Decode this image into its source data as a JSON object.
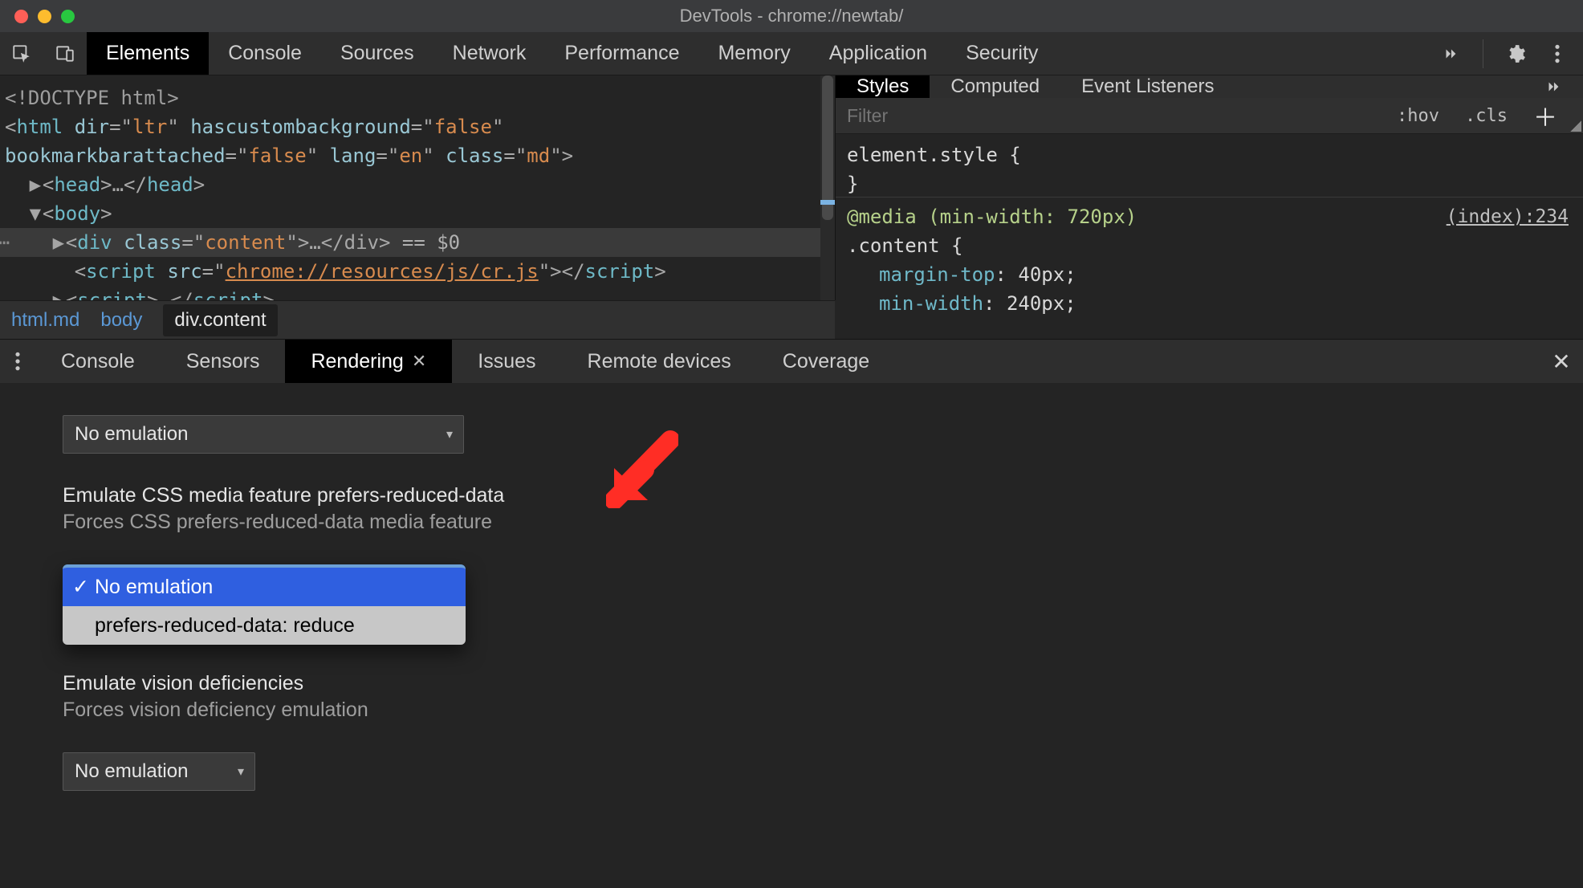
{
  "window": {
    "title": "DevTools - chrome://newtab/"
  },
  "toolbar": {
    "tabs": [
      "Elements",
      "Console",
      "Sources",
      "Network",
      "Performance",
      "Memory",
      "Application",
      "Security"
    ],
    "active": "Elements"
  },
  "dom": {
    "doctype": "<!DOCTYPE html>",
    "html_open_a": "<html ",
    "html_attr_dir_n": "dir",
    "html_attr_dir_v": "ltr",
    "html_attr_hcb_n": "hascustombackground",
    "html_attr_hcb_v": "false",
    "html_attr_bba_n": "bookmarkbarattached",
    "html_attr_bba_v": "false",
    "html_attr_lang_n": "lang",
    "html_attr_lang_v": "en",
    "html_attr_class_n": "class",
    "html_attr_class_v": "md",
    "head_collapsed": "<head>…</head>",
    "body_open": "<body>",
    "selected_open": "<div ",
    "selected_class_n": "class",
    "selected_class_v": "content",
    "selected_close": ">…</div>",
    "selected_eq": " == $0",
    "script1_open": "<script ",
    "script1_src_n": "src",
    "script1_src_v": "chrome://resources/js/cr.js",
    "script1_close": "></scr",
    "script1_close2": "ipt>",
    "script2": "<script>…</scr",
    "script2b": "ipt>"
  },
  "breadcrumb": {
    "a": "html.md",
    "b": "body",
    "c": "div.content"
  },
  "styles": {
    "tabs": [
      "Styles",
      "Computed",
      "Event Listeners"
    ],
    "active": "Styles",
    "filter_placeholder": "Filter",
    "hov": ":hov",
    "cls": ".cls",
    "element_style": "element.style {",
    "brace_close": "}",
    "media": "@media (min-width: 720px)",
    "selector": ".content {",
    "src": "(index):234",
    "p1n": "margin-top",
    "p1v": "40px",
    "p2n": "min-width",
    "p2v": "240px"
  },
  "drawer": {
    "tabs": [
      "Console",
      "Sensors",
      "Rendering",
      "Issues",
      "Remote devices",
      "Coverage"
    ],
    "active": "Rendering",
    "top_select_value": "No emulation",
    "section1_title": "Emulate CSS media feature prefers-reduced-data",
    "section1_sub": "Forces CSS prefers-reduced-data media feature",
    "dropdown_options": [
      "No emulation",
      "prefers-reduced-data: reduce"
    ],
    "dropdown_selected": "No emulation",
    "section2_title": "Emulate vision deficiencies",
    "section2_sub": "Forces vision deficiency emulation",
    "section2_select_value": "No emulation"
  },
  "colors": {
    "annotation": "#ff2d25"
  }
}
